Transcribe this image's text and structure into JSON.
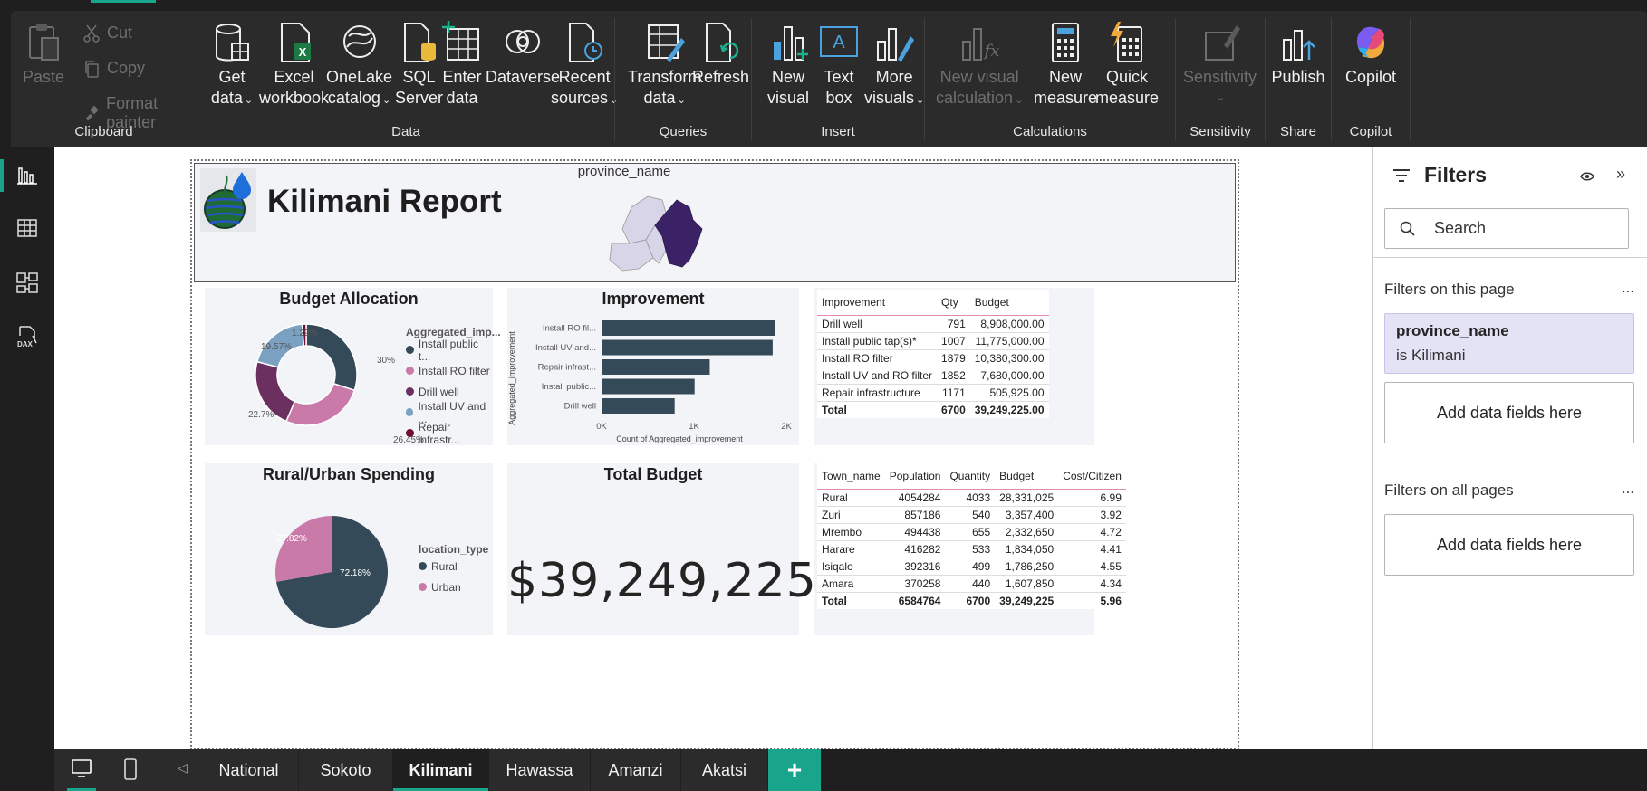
{
  "ribbon": {
    "clipboard": {
      "paste": "Paste",
      "cut": "Cut",
      "copy": "Copy",
      "format_painter": "Format painter",
      "label": "Clipboard"
    },
    "data": {
      "get_data": [
        "Get",
        "data"
      ],
      "excel": [
        "Excel",
        "workbook"
      ],
      "onelake": [
        "OneLake",
        "catalog"
      ],
      "sql": [
        "SQL",
        "Server"
      ],
      "enter": [
        "Enter",
        "data"
      ],
      "dataverse": "Dataverse",
      "recent": [
        "Recent",
        "sources"
      ],
      "label": "Data"
    },
    "queries": {
      "transform": [
        "Transform",
        "data"
      ],
      "refresh": "Refresh",
      "label": "Queries"
    },
    "insert": {
      "new_visual": [
        "New",
        "visual"
      ],
      "text_box": [
        "Text",
        "box"
      ],
      "more_visuals": [
        "More",
        "visuals"
      ],
      "label": "Insert"
    },
    "calculations": {
      "new_visual_calc": [
        "New visual",
        "calculation"
      ],
      "new_measure": [
        "New",
        "measure"
      ],
      "quick_measure": [
        "Quick",
        "measure"
      ],
      "label": "Calculations"
    },
    "sensitivity": {
      "btn": "Sensitivity",
      "label": "Sensitivity"
    },
    "share": {
      "publish": "Publish",
      "label": "Share"
    },
    "copilot": {
      "btn": "Copilot",
      "label": "Copilot"
    }
  },
  "report": {
    "title": "Kilimani Report",
    "map_title": "province_name"
  },
  "budget_allocation": {
    "title": "Budget Allocation",
    "legend_title": "Aggregated_imp...",
    "legend": [
      {
        "label": "Install public t...",
        "color": "#344a59"
      },
      {
        "label": "Install RO filter",
        "color": "#c97aa8"
      },
      {
        "label": "Drill well",
        "color": "#6b2f60"
      },
      {
        "label": "Install UV and ...",
        "color": "#7ba1c2"
      },
      {
        "label": "Repair infrastr...",
        "color": "#6e0f2e"
      }
    ],
    "slice_labels": [
      "30%",
      "26.45%",
      "22.7%",
      "19.57%",
      "1.29%"
    ]
  },
  "improvement_chart": {
    "title": "Improvement",
    "ylabel": "Aggregated_improvement",
    "xlabel": "Count of Aggregated_improvement",
    "ticks": [
      "0K",
      "1K",
      "2K"
    ]
  },
  "improvement_table": {
    "headers": [
      "Improvement",
      "Qty",
      "Budget"
    ],
    "rows": [
      [
        "Drill well",
        "791",
        "8,908,000.00"
      ],
      [
        "Install public tap(s)*",
        "1007",
        "11,775,000.00"
      ],
      [
        "Install RO filter",
        "1879",
        "10,380,300.00"
      ],
      [
        "Install UV and RO filter",
        "1852",
        "7,680,000.00"
      ],
      [
        "Repair infrastructure",
        "1171",
        "505,925.00"
      ]
    ],
    "total": [
      "Total",
      "6700",
      "39,249,225.00"
    ]
  },
  "rural_urban": {
    "title": "Rural/Urban Spending",
    "legend_title": "location_type",
    "legend": [
      {
        "label": "Rural",
        "color": "#344a59"
      },
      {
        "label": "Urban",
        "color": "#c97aa8"
      }
    ],
    "slice_labels": [
      "72.18%",
      "27.82%"
    ]
  },
  "total_budget": {
    "title": "Total Budget",
    "value": "$39,249,225"
  },
  "town_table": {
    "headers": [
      "Town_name",
      "Population",
      "Quantity",
      "Budget",
      "Cost/Citizen"
    ],
    "rows": [
      [
        "Rural",
        "4054284",
        "4033",
        "28,331,025",
        "6.99"
      ],
      [
        "Zuri",
        "857186",
        "540",
        "3,357,400",
        "3.92"
      ],
      [
        "Mrembo",
        "494438",
        "655",
        "2,332,650",
        "4.72"
      ],
      [
        "Harare",
        "416282",
        "533",
        "1,834,050",
        "4.41"
      ],
      [
        "Isiqalo",
        "392316",
        "499",
        "1,786,250",
        "4.55"
      ],
      [
        "Amara",
        "370258",
        "440",
        "1,607,850",
        "4.34"
      ]
    ],
    "total": [
      "Total",
      "6584764",
      "6700",
      "39,249,225",
      "5.96"
    ]
  },
  "filters": {
    "title": "Filters",
    "search_placeholder": "Search",
    "on_this_page": "Filters on this page",
    "active_filter_name": "province_name",
    "active_filter_value": "is Kilimani",
    "add_fields": "Add data fields here",
    "on_all_pages": "Filters on all pages",
    "more": "..."
  },
  "tabs": [
    "National",
    "Sokoto",
    "Kilimani",
    "Hawassa",
    "Amanzi",
    "Akatsi"
  ],
  "active_tab": "Kilimani",
  "chart_data": [
    {
      "type": "pie",
      "title": "Budget Allocation",
      "categories": [
        "Install public tap(s)*",
        "Install RO filter",
        "Drill well",
        "Install UV and RO filter",
        "Repair infrastructure"
      ],
      "values": [
        30.0,
        26.45,
        22.7,
        19.57,
        1.29
      ]
    },
    {
      "type": "bar",
      "title": "Improvement",
      "categories": [
        "Install RO filter",
        "Install UV and RO filter",
        "Repair infrastructure",
        "Install public tap(s)*",
        "Drill well"
      ],
      "values": [
        1879,
        1852,
        1171,
        1007,
        791
      ],
      "xlabel": "Count of Aggregated_improvement",
      "ylabel": "Aggregated_improvement",
      "xlim": [
        0,
        2000
      ]
    },
    {
      "type": "pie",
      "title": "Rural/Urban Spending",
      "categories": [
        "Rural",
        "Urban"
      ],
      "values": [
        72.18,
        27.82
      ]
    }
  ]
}
